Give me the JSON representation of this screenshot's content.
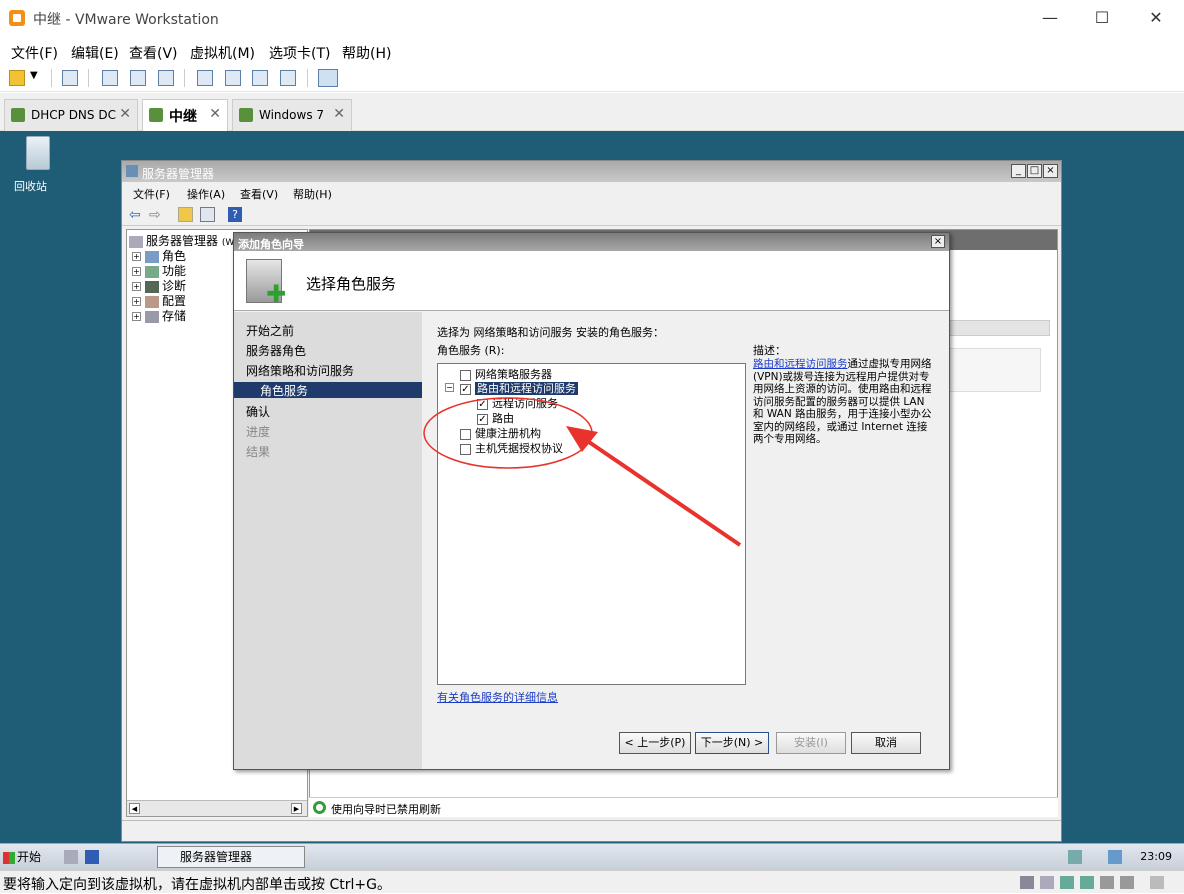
{
  "vm": {
    "title": "中继 - VMware Workstation",
    "menu": [
      "文件(F)",
      "编辑(E)",
      "查看(V)",
      "虚拟机(M)",
      "选项卡(T)",
      "帮助(H)"
    ],
    "tabs": [
      {
        "label": "DHCP DNS DC",
        "active": false
      },
      {
        "label": "中继",
        "active": true
      },
      {
        "label": "Windows 7",
        "active": false
      }
    ],
    "status_message": "要将输入定向到该虚拟机，请在虚拟机内部单击或按 Ctrl+G。"
  },
  "desktop": {
    "recycle_bin_label": "回收站"
  },
  "server_manager": {
    "title": "服务器管理器",
    "menu": [
      "文件(F)",
      "操作(A)",
      "查看(V)",
      "帮助(H)"
    ],
    "tree": {
      "root": "服务器管理器",
      "root_suffix": "(W",
      "items": [
        "角色",
        "功能",
        "诊断",
        "配置",
        "存储"
      ]
    },
    "status_text": "使用向导时已禁用刷新"
  },
  "wizard": {
    "title": "添加角色向导",
    "heading": "选择角色服务",
    "nav": [
      {
        "label": "开始之前",
        "state": "normal"
      },
      {
        "label": "服务器角色",
        "state": "normal"
      },
      {
        "label": "网络策略和访问服务",
        "state": "normal"
      },
      {
        "label": "角色服务",
        "state": "selected"
      },
      {
        "label": "确认",
        "state": "normal"
      },
      {
        "label": "进度",
        "state": "disabled"
      },
      {
        "label": "结果",
        "state": "disabled"
      }
    ],
    "prompt": "选择为 网络策略和访问服务 安装的角色服务：",
    "list_label": "角色服务 (R):",
    "services": {
      "nps": {
        "label": "网络策略服务器",
        "checked": false
      },
      "rras": {
        "label": "路由和远程访问服务",
        "checked": true,
        "expand": "−"
      },
      "remote_access": {
        "label": "远程访问服务",
        "checked": true
      },
      "routing": {
        "label": "路由",
        "checked": true
      },
      "hra": {
        "label": "健康注册机构",
        "checked": false
      },
      "hcap": {
        "label": "主机凭据授权协议",
        "checked": false
      }
    },
    "description_label": "描述：",
    "description_link": "路由和远程访问服务",
    "description_text": "通过虚拟专用网络(VPN)或拨号连接为远程用户提供对专用网络上资源的访问。使用路由和远程访问服务配置的服务器可以提供 LAN 和 WAN 路由服务，用于连接小型办公室内的网络段，或通过 Internet 连接两个专用网络。",
    "more_link": "有关角色服务的详细信息",
    "buttons": {
      "back": "< 上一步(P)",
      "next": "下一步(N) >",
      "install": "安装(I)",
      "cancel": "取消"
    }
  },
  "taskbar": {
    "start": "开始",
    "app": "服务器管理器",
    "clock": "23:09"
  },
  "annotation": {
    "color": "#e8322b"
  }
}
